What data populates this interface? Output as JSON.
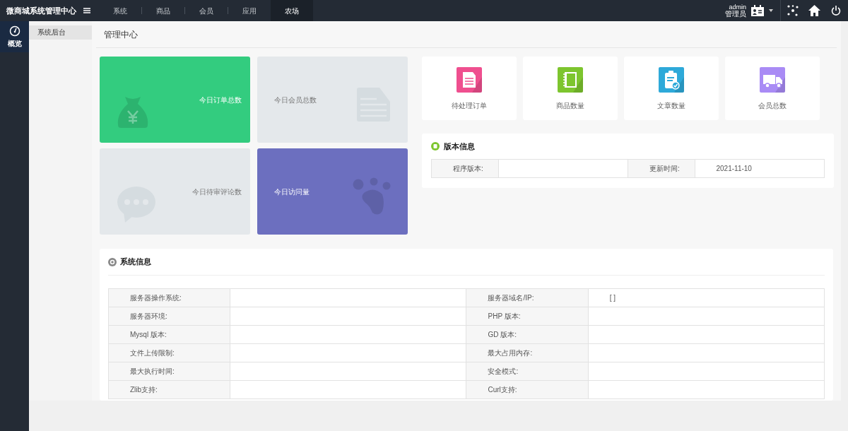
{
  "topbar": {
    "title": "微商城系统管理中心",
    "menu": [
      {
        "label": "系统",
        "selected": false
      },
      {
        "label": "商品",
        "selected": false
      },
      {
        "label": "会员",
        "selected": false
      },
      {
        "label": "应用",
        "selected": false
      },
      {
        "label": "农场",
        "selected": true
      }
    ],
    "user": {
      "name": "admin",
      "role": "管理员"
    }
  },
  "sidebar": {
    "items": [
      {
        "label": "概览",
        "selected": true
      }
    ]
  },
  "subnav": {
    "items": [
      {
        "label": "系统后台",
        "selected": true
      }
    ]
  },
  "page_title": "管理中心",
  "tiles": [
    {
      "label": "今日订单总数",
      "kind": "money",
      "color": "#33cc7f"
    },
    {
      "label": "今日会员总数",
      "kind": "document",
      "color": "#e4e8eb"
    },
    {
      "label": "今日待审评论数",
      "kind": "chat",
      "color": "#e4e8eb"
    },
    {
      "label": "今日访问量",
      "kind": "paw",
      "color": "#6c6fbf"
    }
  ],
  "stats": [
    {
      "label": "待处理订单",
      "kind": "order",
      "color": "#ef4f8f"
    },
    {
      "label": "商品数量",
      "kind": "notebook",
      "color": "#7dc52e"
    },
    {
      "label": "文章数量",
      "kind": "clipboard",
      "color": "#2ea9d9"
    },
    {
      "label": "会员总数",
      "kind": "truck",
      "color": "#a98bf5"
    }
  ],
  "version": {
    "title": "版本信息",
    "rows": [
      [
        "程序版本:",
        "",
        "更新时间:",
        "2021-11-10"
      ]
    ]
  },
  "system": {
    "title": "系统信息",
    "rows": [
      [
        "服务器操作系统:",
        "",
        "服务器域名/IP:",
        "[ ]"
      ],
      [
        "服务器环境:",
        "",
        "PHP 版本:",
        ""
      ],
      [
        "Mysql 版本:",
        "",
        "GD 版本:",
        ""
      ],
      [
        "文件上传限制:",
        "",
        "最大占用内存:",
        ""
      ],
      [
        "最大执行时间:",
        "",
        "安全模式:",
        ""
      ],
      [
        "Zlib支持:",
        "",
        "Curl支持:",
        ""
      ]
    ]
  }
}
